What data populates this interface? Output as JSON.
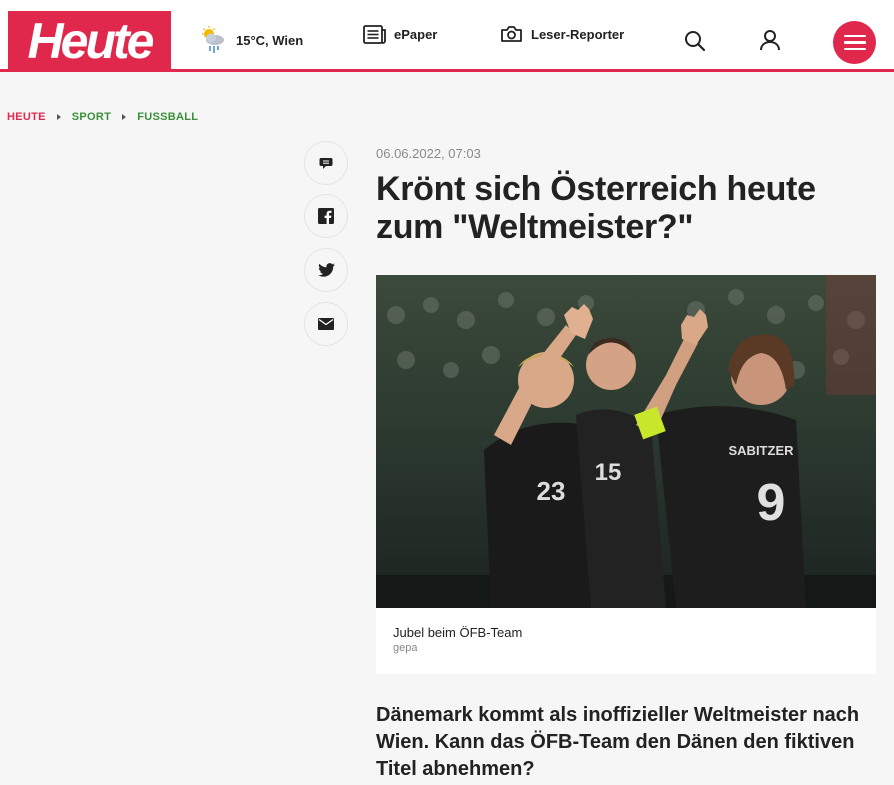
{
  "header": {
    "logo_text": "Heute",
    "weather": {
      "text": "15°C, Wien",
      "icon": "weather-icon"
    },
    "epaper": {
      "label": "ePaper",
      "icon": "newspaper-icon"
    },
    "reporter": {
      "label": "Leser-Reporter",
      "icon": "camera-icon"
    },
    "search_icon": "search-icon",
    "user_icon": "user-icon",
    "menu_icon": "menu-icon"
  },
  "breadcrumb": [
    "HEUTE",
    "SPORT",
    "FUSSBALL"
  ],
  "share": [
    "comment-icon",
    "facebook-icon",
    "twitter-icon",
    "mail-icon"
  ],
  "article": {
    "date": "06.06.2022, 07:03",
    "headline": "Krönt sich Österreich heute zum \"Weltmeister?\"",
    "image": {
      "caption": "Jubel beim ÖFB-Team",
      "credit": "gepa",
      "jersey_numbers": [
        "23",
        "15",
        "9"
      ],
      "jersey_name": "SABITZER"
    },
    "lead": "Dänemark kommt als inoffizieller Weltmeister nach Wien. Kann das ÖFB-Team den Dänen den fiktiven Titel abnehmen?"
  },
  "colors": {
    "brand": "#e0284c",
    "breadcrumb_green": "#3a8f3a",
    "background": "#f5f6f5"
  }
}
